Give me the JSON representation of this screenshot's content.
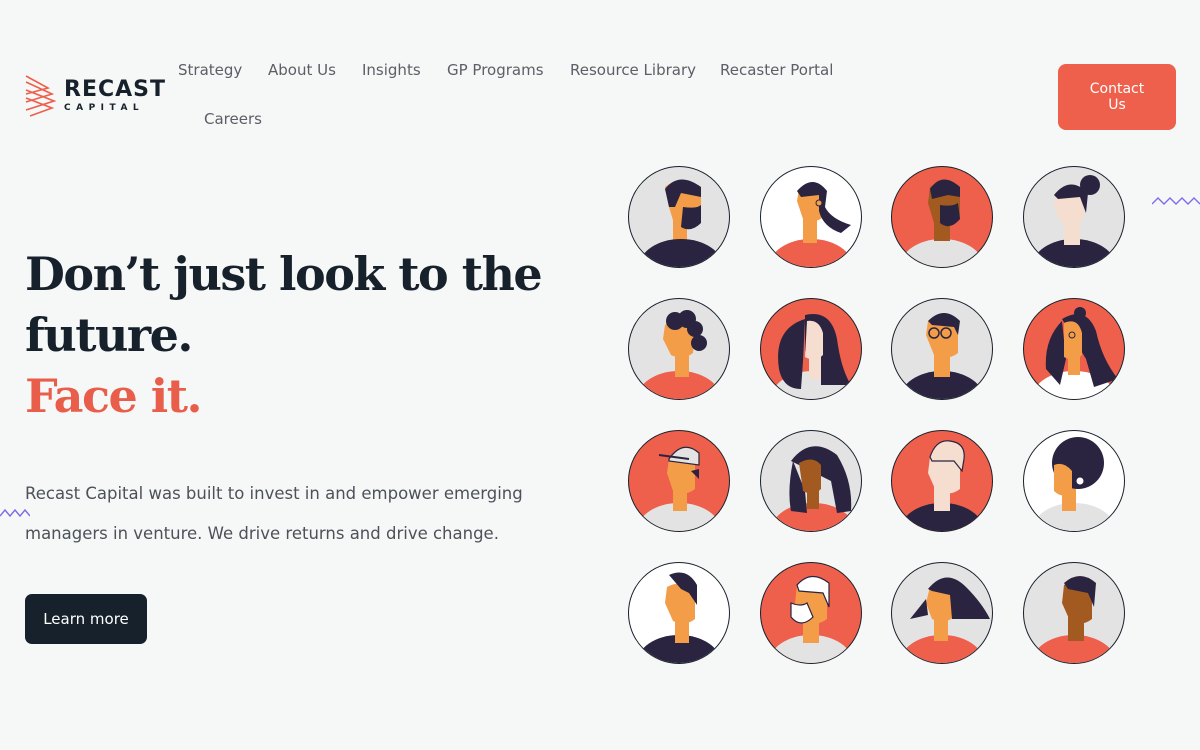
{
  "brand": {
    "name": "RECAST",
    "subname": "CAPITAL",
    "accent_color": "#ee5f4c",
    "dark_color": "#17212b"
  },
  "nav": {
    "items": [
      {
        "label": "Strategy"
      },
      {
        "label": "About Us"
      },
      {
        "label": "Insights"
      },
      {
        "label": "GP Programs"
      },
      {
        "label": "Resource Library"
      },
      {
        "label": "Recaster Portal"
      },
      {
        "label": "Careers"
      }
    ],
    "contact_label": "Contact Us"
  },
  "hero": {
    "title_line1": "Don’t just look to the",
    "title_line2": "future.",
    "title_accent": "Face it.",
    "description": "Recast Capital was built to invest in and empower emerging managers in venture. We drive returns and drive change.",
    "cta_label": "Learn more"
  },
  "avatars": [
    {
      "icon": "man-beard-avatar-icon",
      "bg": "#e3e3e3"
    },
    {
      "icon": "woman-ponytail-avatar-icon",
      "bg": "#ffffff"
    },
    {
      "icon": "man-beard-dark-avatar-icon",
      "bg": "#ee5f4c"
    },
    {
      "icon": "woman-bun-avatar-icon",
      "bg": "#e3e3e3"
    },
    {
      "icon": "man-curly-avatar-icon",
      "bg": "#e3e3e3"
    },
    {
      "icon": "woman-long-hair-avatar-icon",
      "bg": "#ee5f4c"
    },
    {
      "icon": "man-glasses-avatar-icon",
      "bg": "#e3e3e3"
    },
    {
      "icon": "woman-wavy-avatar-icon",
      "bg": "#ee5f4c"
    },
    {
      "icon": "man-cap-avatar-icon",
      "bg": "#ee5f4c"
    },
    {
      "icon": "woman-braids-avatar-icon",
      "bg": "#e3e3e3"
    },
    {
      "icon": "man-white-hair-avatar-icon",
      "bg": "#ee5f4c"
    },
    {
      "icon": "person-afro-avatar-icon",
      "bg": "#ffffff"
    },
    {
      "icon": "man-quiff-avatar-icon",
      "bg": "#ffffff"
    },
    {
      "icon": "man-white-beard-avatar-icon",
      "bg": "#ee5f4c"
    },
    {
      "icon": "woman-side-hair-avatar-icon",
      "bg": "#e3e3e3"
    },
    {
      "icon": "man-brown-avatar-icon",
      "bg": "#e3e3e3"
    }
  ]
}
